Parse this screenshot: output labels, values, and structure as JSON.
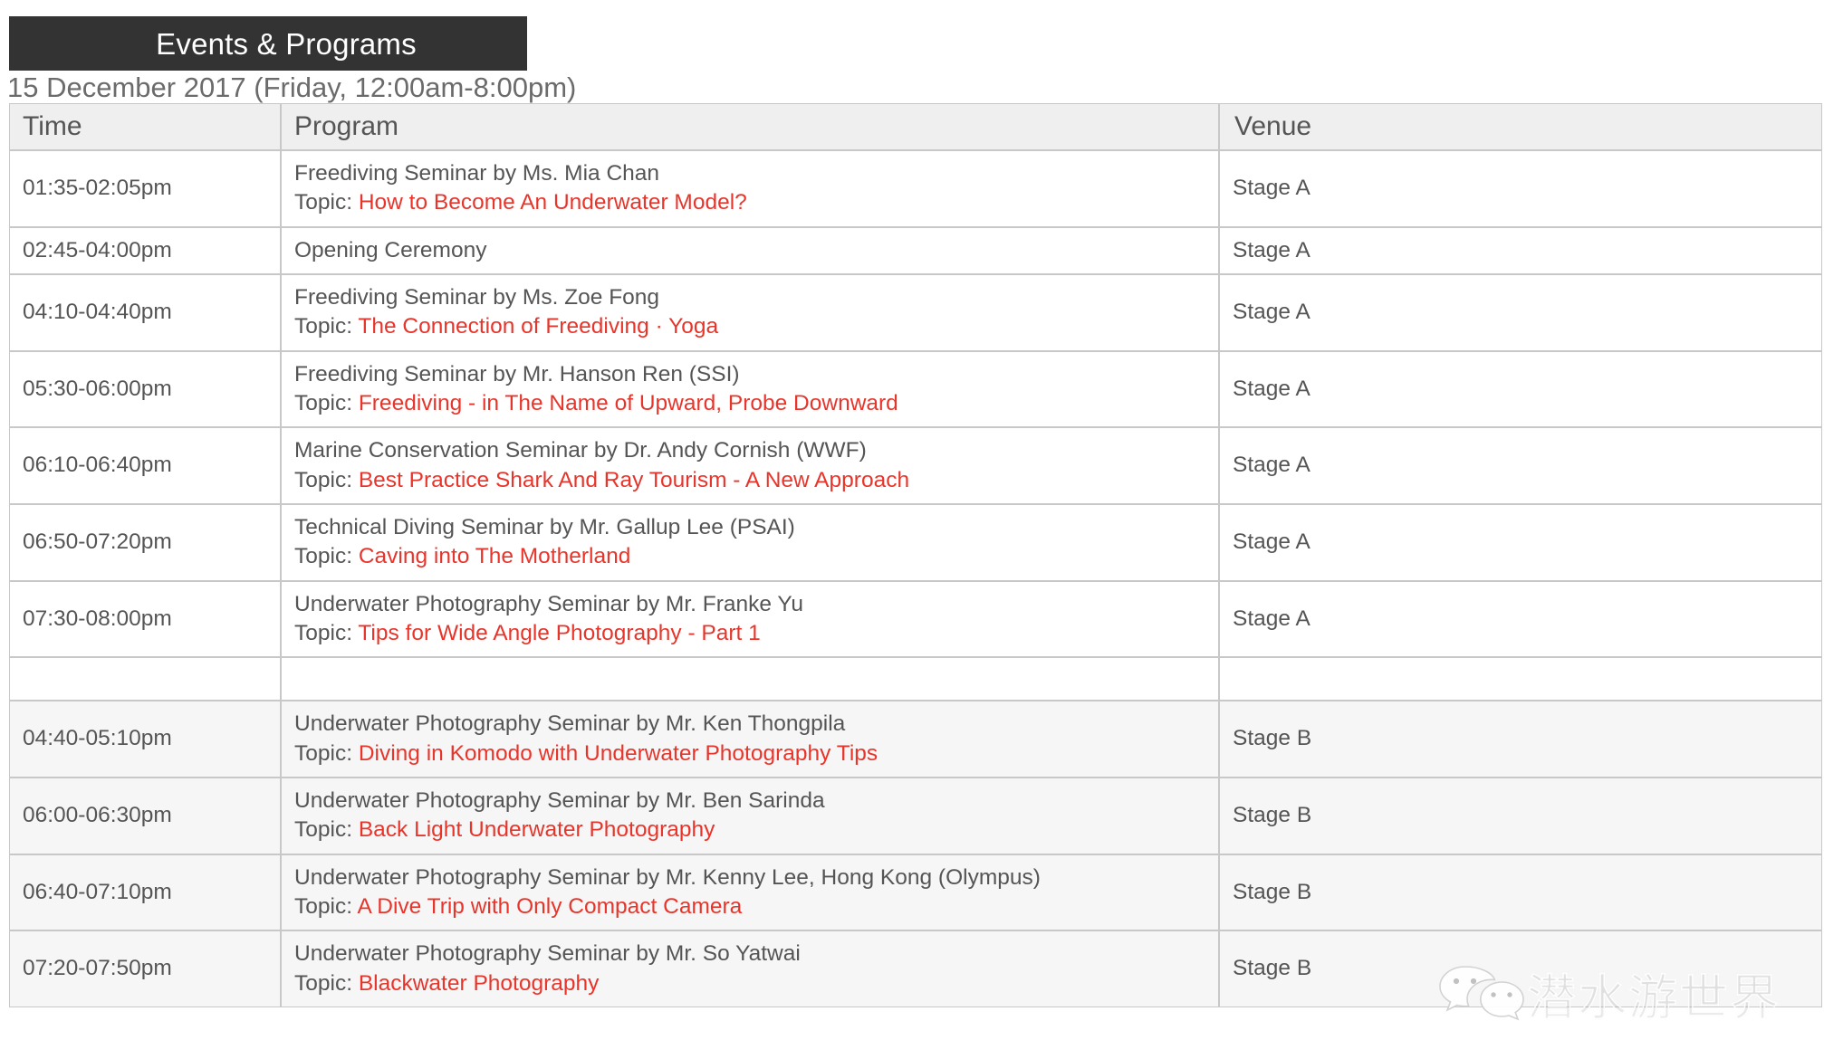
{
  "header": {
    "badge_title": "Events & Programs",
    "date_line": "15 December 2017 (Friday, 12:00am-8:00pm)"
  },
  "colors": {
    "badge_bg": "#333333",
    "topic_red": "#e8352b",
    "body_text": "#555555",
    "header_row_bg": "#efefef",
    "shaded_row_bg": "#f6f6f6",
    "border": "#c8c8c8"
  },
  "table": {
    "columns": [
      "Time",
      "Program",
      "Venue"
    ],
    "topic_label": "Topic: ",
    "rows": [
      {
        "time": "01:35-02:05pm",
        "program_title": "Freediving Seminar by Ms. Mia Chan",
        "topic": "How to Become An Underwater Model?",
        "venue": "Stage A"
      },
      {
        "time": "02:45-04:00pm",
        "program_title": "Opening Ceremony",
        "topic": "",
        "venue": "Stage A"
      },
      {
        "time": "04:10-04:40pm",
        "program_title": "Freediving Seminar by Ms. Zoe Fong",
        "topic": "The Connection of Freediving · Yoga",
        "venue": "Stage A"
      },
      {
        "time": "05:30-06:00pm",
        "program_title": "Freediving Seminar by Mr. Hanson Ren (SSI)",
        "topic": "Freediving - in The Name of Upward, Probe Downward",
        "venue": "Stage A"
      },
      {
        "time": "06:10-06:40pm",
        "program_title": "Marine Conservation Seminar by Dr. Andy Cornish (WWF)",
        "topic": "Best Practice Shark And Ray Tourism - A New Approach",
        "venue": "Stage A"
      },
      {
        "time": "06:50-07:20pm",
        "program_title": "Technical Diving Seminar by Mr. Gallup Lee (PSAI)",
        "topic": "Caving into The Motherland",
        "venue": "Stage A"
      },
      {
        "time": "07:30-08:00pm",
        "program_title": "Underwater Photography Seminar by Mr. Franke Yu",
        "topic": "Tips for Wide Angle Photography - Part 1",
        "venue": "Stage A"
      },
      {
        "time": "",
        "program_title": "",
        "topic": "",
        "venue": ""
      },
      {
        "time": "04:40-05:10pm",
        "program_title": "Underwater Photography Seminar by Mr. Ken Thongpila",
        "topic": "Diving in Komodo with Underwater Photography Tips",
        "venue": "Stage B"
      },
      {
        "time": "06:00-06:30pm",
        "program_title": "Underwater Photography Seminar by Mr. Ben Sarinda",
        "topic": "Back Light Underwater Photography",
        "venue": "Stage B"
      },
      {
        "time": "06:40-07:10pm",
        "program_title": "Underwater Photography Seminar by Mr. Kenny Lee, Hong Kong (Olympus)",
        "topic": "A Dive Trip with Only Compact Camera",
        "venue": "Stage B"
      },
      {
        "time": "07:20-07:50pm",
        "program_title": "Underwater Photography Seminar by Mr. So Yatwai",
        "topic": "Blackwater Photography",
        "venue": "Stage B"
      }
    ]
  },
  "watermark": {
    "text": "潜水游世界",
    "icon": "wechat-icon"
  }
}
